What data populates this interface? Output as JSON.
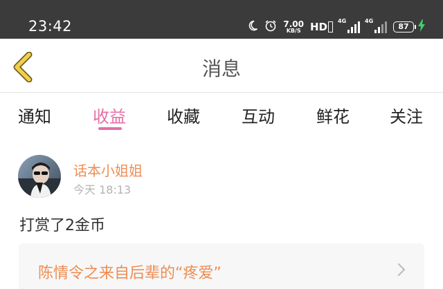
{
  "status_bar": {
    "time": "23:42",
    "speed_value": "7.00",
    "speed_unit": "KB/S",
    "hd_label": "HD",
    "net1": "4G",
    "net2": "4G",
    "battery": "87",
    "icons": [
      "moon-icon",
      "alarm-icon",
      "signal-icon",
      "battery-icon",
      "charging-bolt-icon"
    ]
  },
  "header": {
    "title": "消息",
    "back_icon": "chevron-left-icon",
    "back_color": "#f2cf48"
  },
  "tabs": [
    {
      "label": "通知",
      "active": false
    },
    {
      "label": "收益",
      "active": true
    },
    {
      "label": "收藏",
      "active": false
    },
    {
      "label": "互动",
      "active": false
    },
    {
      "label": "鲜花",
      "active": false
    },
    {
      "label": "关注",
      "active": false
    }
  ],
  "message": {
    "username": "话本小姐姐",
    "time": "今天 18:13",
    "text": "打赏了2金币",
    "link_text": "陈情令之来自后辈的“疼爱”",
    "link_icon": "chevron-right-icon"
  },
  "colors": {
    "accent_pink": "#e46fa6",
    "accent_orange": "#ee8c53",
    "status_bar_bg": "#3b3b3b",
    "charge_green": "#3ecf6e"
  }
}
